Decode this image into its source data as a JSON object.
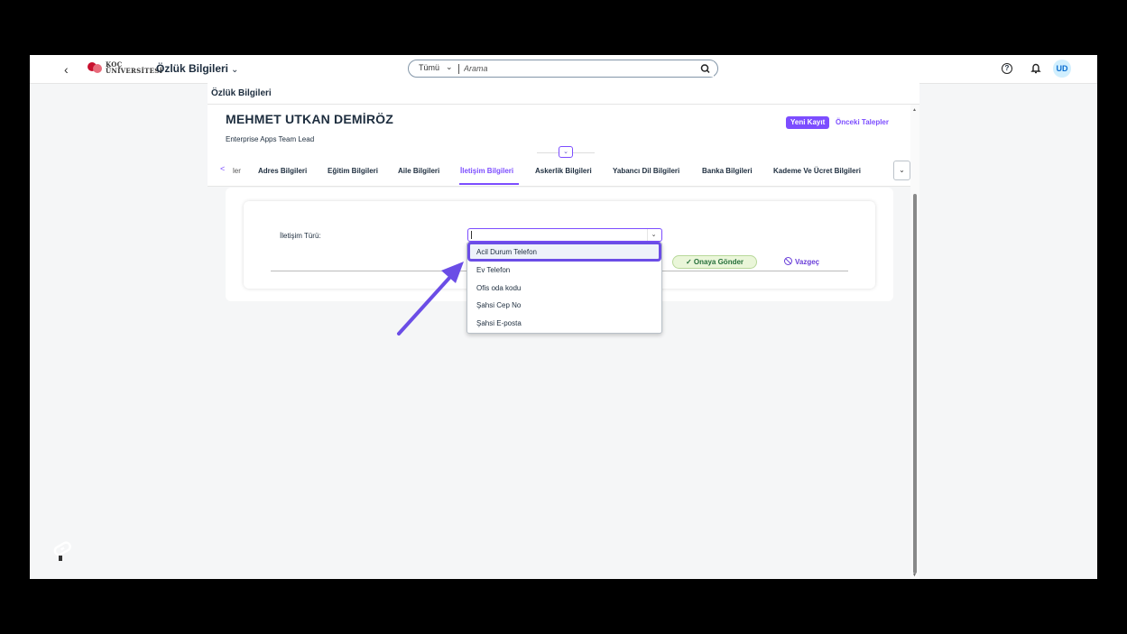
{
  "shellbar": {
    "back_icon": "chevron-left-icon",
    "logo_line1": "KOÇ",
    "logo_line2": "ÜNİVERSİTESİ",
    "app_title": "Özlük Bilgileri",
    "app_title_chevron": "⌄",
    "search_scope": "Tümü",
    "search_scope_chevron": "⌄",
    "search_placeholder": "Arama",
    "help_icon_glyph": "?",
    "avatar_initials": "UD"
  },
  "page": {
    "title": "Özlük Bilgileri",
    "employee_name": "MEHMET UTKAN DEMİRÖZ",
    "employee_role": "Enterprise Apps Team Lead",
    "new_record_button": "Yeni Kayıt",
    "previous_requests_button": "Önceki Talepler",
    "collapse_glyph": "⌄"
  },
  "tabs": {
    "prev_glyph": "<",
    "items": [
      {
        "label": "ler"
      },
      {
        "label": "Adres Bilgileri"
      },
      {
        "label": "Eğitim Bilgileri"
      },
      {
        "label": "Aile Bilgileri"
      },
      {
        "label": "İletişim Bilgileri",
        "active": true
      },
      {
        "label": "Askerlik Bilgileri"
      },
      {
        "label": "Yabancı Dil Bilgileri"
      },
      {
        "label": "Banka Bilgileri"
      },
      {
        "label": "Kademe Ve Ücret Bilgileri"
      }
    ],
    "overflow_glyph": "⌄"
  },
  "form": {
    "contact_type_label": "İletişim Türü:",
    "contact_type_value": "",
    "select_chevron": "⌄",
    "send_button_icon": "✓",
    "send_button": "Onaya Gönder",
    "cancel_button": "Vazgeç"
  },
  "dropdown": {
    "options": [
      "Acil Durum Telefon",
      "Ev Telefon",
      "Ofis oda kodu",
      "Şahsi Cep No",
      "Şahsi E-posta"
    ],
    "highlighted": "Acil Durum Telefon"
  },
  "colors": {
    "accent": "#7c4dff",
    "highlight_border": "#6b4de6",
    "send_bg": "#eaf6d9",
    "avatar_bg": "#d1effe"
  }
}
